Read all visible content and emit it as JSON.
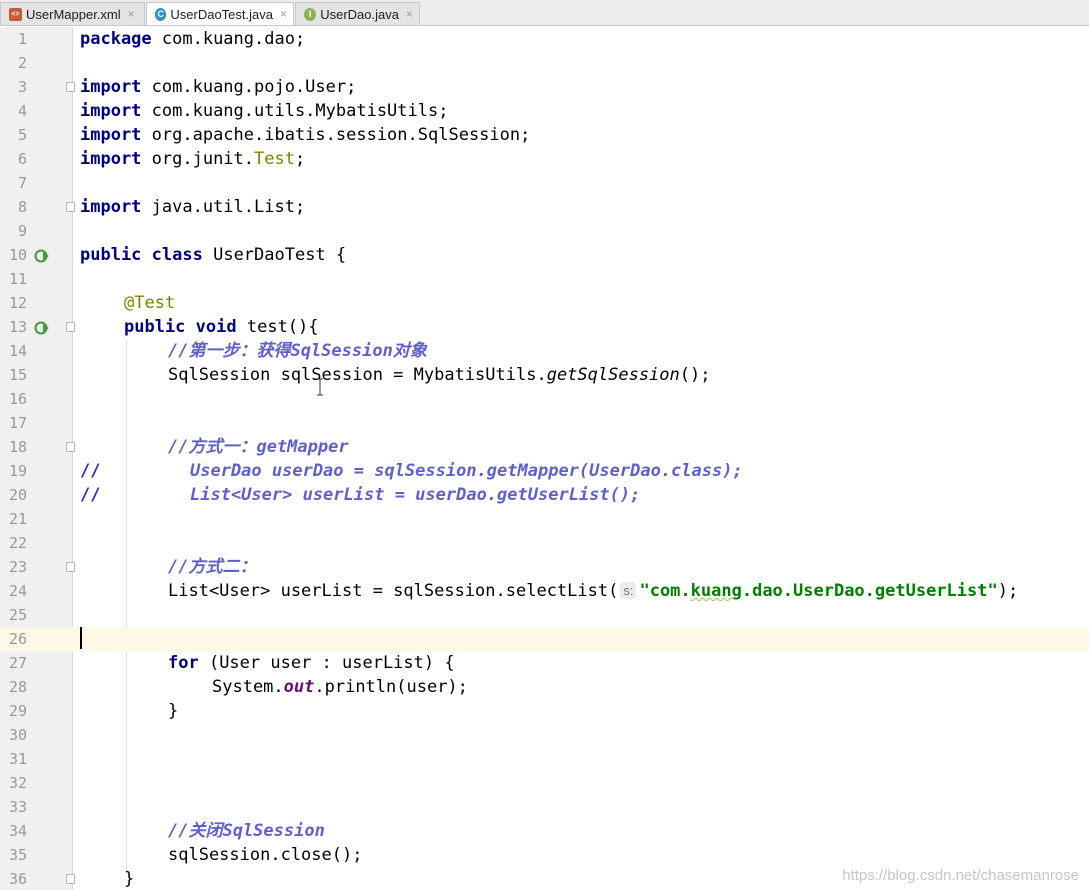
{
  "tabs": [
    {
      "label": "UserMapper.xml",
      "icon": "xml-file-icon",
      "active": false
    },
    {
      "label": "UserDaoTest.java",
      "icon": "class-file-icon",
      "active": true
    },
    {
      "label": "UserDao.java",
      "icon": "interface-file-icon",
      "active": false
    }
  ],
  "tab_close_glyph": "×",
  "icon_letters": {
    "xml": "<>",
    "class": "C",
    "interface": "I"
  },
  "lines": [
    {
      "n": "1"
    },
    {
      "n": "2"
    },
    {
      "n": "3"
    },
    {
      "n": "4"
    },
    {
      "n": "5"
    },
    {
      "n": "6"
    },
    {
      "n": "7"
    },
    {
      "n": "8"
    },
    {
      "n": "9"
    },
    {
      "n": "10"
    },
    {
      "n": "11"
    },
    {
      "n": "12"
    },
    {
      "n": "13"
    },
    {
      "n": "14"
    },
    {
      "n": "15"
    },
    {
      "n": "16"
    },
    {
      "n": "17"
    },
    {
      "n": "18"
    },
    {
      "n": "19"
    },
    {
      "n": "20"
    },
    {
      "n": "21"
    },
    {
      "n": "22"
    },
    {
      "n": "23"
    },
    {
      "n": "24"
    },
    {
      "n": "25"
    },
    {
      "n": "26"
    },
    {
      "n": "27"
    },
    {
      "n": "28"
    },
    {
      "n": "29"
    },
    {
      "n": "30"
    },
    {
      "n": "31"
    },
    {
      "n": "32"
    },
    {
      "n": "33"
    },
    {
      "n": "34"
    },
    {
      "n": "35"
    },
    {
      "n": "36"
    }
  ],
  "code": {
    "l1_kw": "package",
    "l1_rest": " com.kuang.dao;",
    "l3_kw": "import",
    "l3_rest": " com.kuang.pojo.User;",
    "l4_kw": "import",
    "l4_rest": " com.kuang.utils.MybatisUtils;",
    "l5_kw": "import",
    "l5_rest": " org.apache.ibatis.session.SqlSession;",
    "l6_kw": "import",
    "l6_a": " org.junit.",
    "l6_ann": "Test",
    "l6_b": ";",
    "l8_kw": "import",
    "l8_rest": " java.util.List;",
    "l10_kw1": "public",
    "l10_kw2": "class",
    "l10_rest": " UserDaoTest {",
    "l12_ann": "@Test",
    "l13_kw1": "public",
    "l13_kw2": "void",
    "l13_rest": " test(){",
    "l14_cmt": "//第一步：获得SqlSession对象",
    "l15_a": "SqlSession sqlSession = MybatisUtils.",
    "l15_ital": "getSqlSession",
    "l15_b": "();",
    "l18_cmt": "//方式一：getMapper",
    "l19_slash": "//",
    "l19_cmt": "UserDao userDao = sqlSession.getMapper(UserDao.class);",
    "l20_slash": "//",
    "l20_cmt": "List<User> userList = userDao.getUserList();",
    "l23_cmt": "//方式二：",
    "l24_a": "List<User> userList = sqlSession.selectList(",
    "l24_hint": "s:",
    "l24_str_a": "\"com.",
    "l24_str_typo": "kuang",
    "l24_str_b": ".dao.UserDao.getUserList\"",
    "l24_b": ");",
    "l27_kw": "for",
    "l27_rest": " (User user : userList) {",
    "l28_a": "System.",
    "l28_field": "out",
    "l28_b": ".println(user);",
    "l29": "}",
    "l34_cmt": "//关闭SqlSession",
    "l35": "sqlSession.close();",
    "l36": "}"
  },
  "watermark": "https://blog.csdn.net/chasemanrose"
}
